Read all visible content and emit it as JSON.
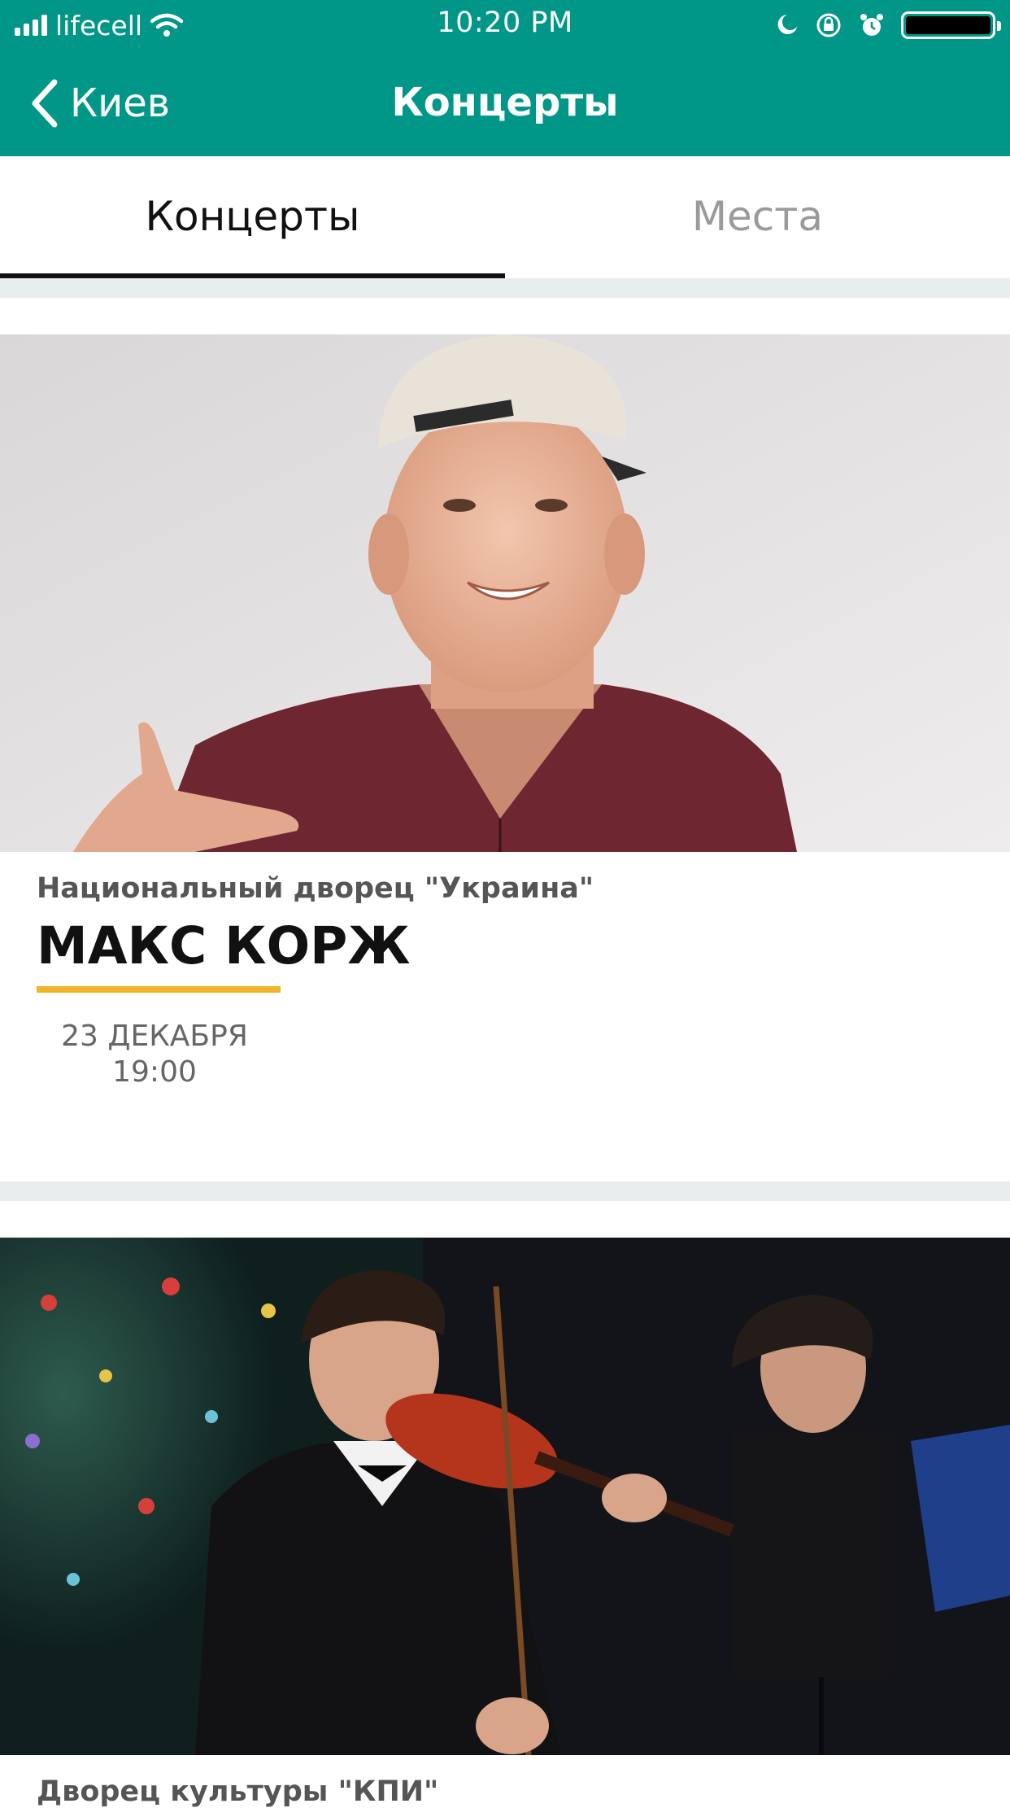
{
  "status_bar": {
    "carrier": "lifecell",
    "time": "10:20 PM"
  },
  "nav": {
    "back_label": "Киев",
    "title": "Концерты"
  },
  "tabs": [
    {
      "label": "Концерты",
      "active": true
    },
    {
      "label": "Места",
      "active": false
    }
  ],
  "concerts": [
    {
      "venue": "Национальный дворец \"Украина\"",
      "title": "МАКС КОРЖ",
      "date": "23 ДЕКАБРЯ",
      "time": "19:00"
    },
    {
      "venue": "Дворец культуры \"КПИ\""
    }
  ],
  "colors": {
    "header_bg": "#009688",
    "accent_underline": "#f0b429",
    "separator": "#e9eded"
  }
}
